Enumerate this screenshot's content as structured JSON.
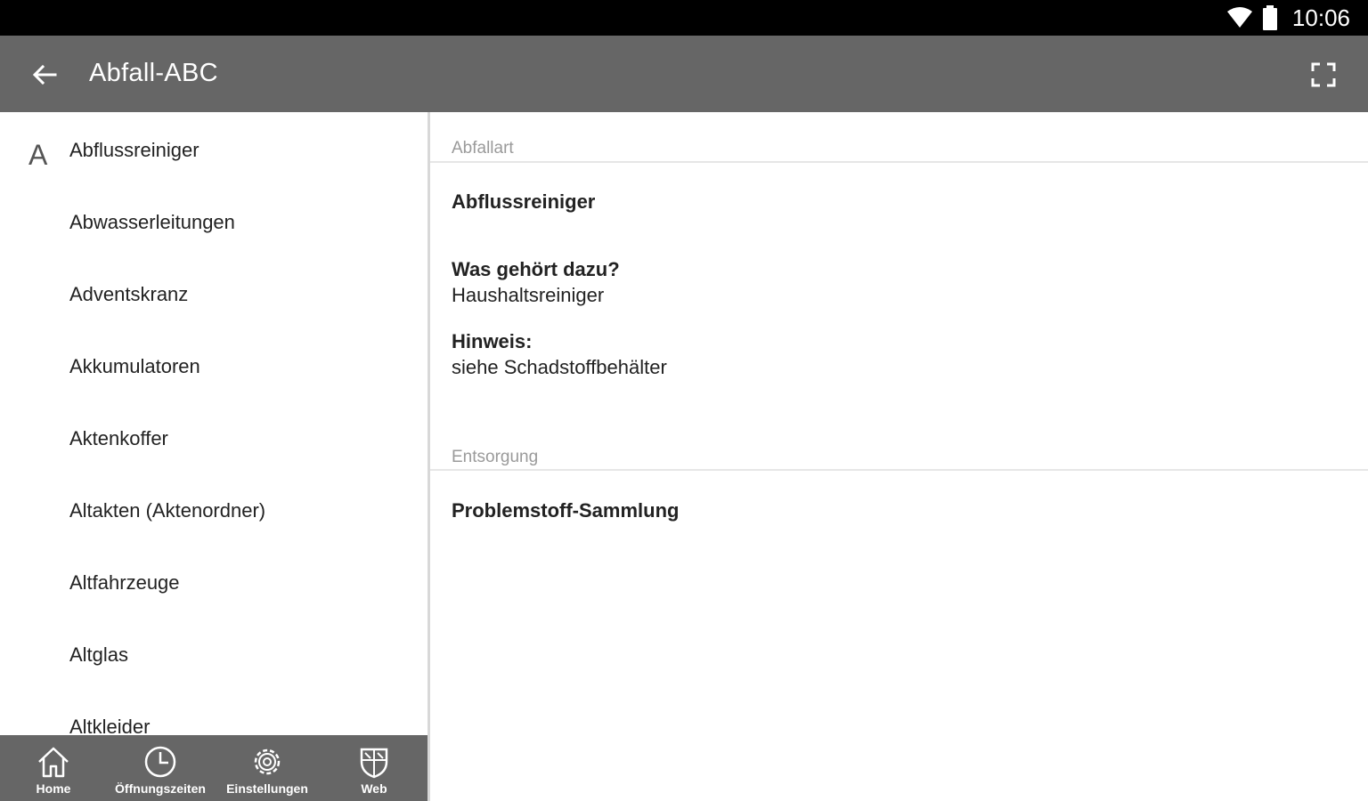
{
  "status_bar": {
    "time": "10:06",
    "icons": [
      "wifi-icon",
      "battery-icon"
    ]
  },
  "toolbar": {
    "title": "Abfall-ABC",
    "back_icon": "arrow-left-icon",
    "fullscreen_icon": "fullscreen-icon"
  },
  "list": {
    "section_letter": "A",
    "items": [
      "Abflussreiniger",
      "Abwasserleitungen",
      "Adventskranz",
      "Akkumulatoren",
      "Aktenkoffer",
      "Altakten (Aktenordner)",
      "Altfahrzeuge",
      "Altglas",
      "Altkleider"
    ]
  },
  "bottom_nav": {
    "items": [
      {
        "label": "Home",
        "icon": "home-icon"
      },
      {
        "label": "Öffnungszeiten",
        "icon": "clock-icon"
      },
      {
        "label": "Einstellungen",
        "icon": "gear-icon"
      },
      {
        "label": "Web",
        "icon": "shield-icon"
      }
    ]
  },
  "detail": {
    "abfallart_header": "Abfallart",
    "item_name": "Abflussreiniger",
    "q_label": "Was gehört dazu?",
    "q_value": "Haushaltsreiniger",
    "hint_label": "Hinweis:",
    "hint_value": "siehe Schadstoffbehälter",
    "entsorgung_header": "Entsorgung",
    "entsorgung_value": "Problemstoff-Sammlung"
  },
  "colors": {
    "status_bar": "#000000",
    "toolbar": "#666666",
    "bottom_nav": "#666666",
    "divider": "#d8d8d8",
    "section_header_text": "#9a9a9a"
  }
}
